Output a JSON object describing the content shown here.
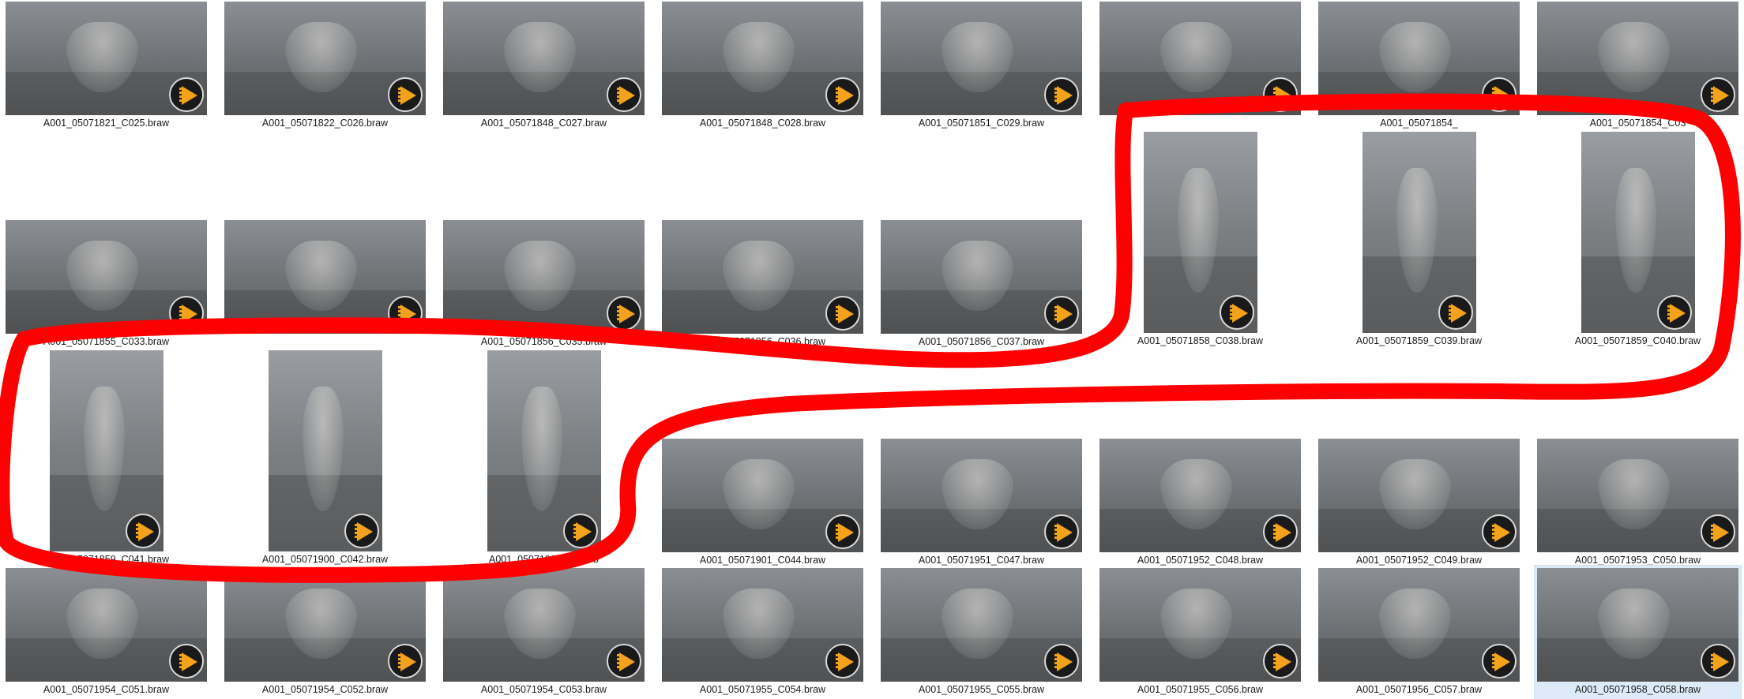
{
  "view": {
    "annotation_color": "#ff0000",
    "badge_icon": "braw-play-icon",
    "selected_item": "A001_05071958_C058.braw"
  },
  "items": [
    {
      "name": "A001_05071821_C025.braw",
      "orientation": "landscape"
    },
    {
      "name": "A001_05071822_C026.braw",
      "orientation": "landscape"
    },
    {
      "name": "A001_05071848_C027.braw",
      "orientation": "landscape"
    },
    {
      "name": "A001_05071848_C028.braw",
      "orientation": "landscape"
    },
    {
      "name": "A001_05071851_C029.braw",
      "orientation": "landscape"
    },
    {
      "name": "",
      "orientation": "landscape"
    },
    {
      "name": "A001_05071854_",
      "orientation": "landscape"
    },
    {
      "name": "A001_05071854_C03",
      "orientation": "landscape"
    },
    {
      "name": "A001_05071855_C033.braw",
      "orientation": "landscape"
    },
    {
      "name": "",
      "orientation": "landscape"
    },
    {
      "name": "A001_05071856_C035.braw",
      "orientation": "landscape"
    },
    {
      "name": "A001_05071856_C036.braw",
      "orientation": "landscape"
    },
    {
      "name": "A001_05071856_C037.braw",
      "orientation": "landscape"
    },
    {
      "name": "A001_05071858_C038.braw",
      "orientation": "portrait"
    },
    {
      "name": "A001_05071859_C039.braw",
      "orientation": "portrait"
    },
    {
      "name": "A001_05071859_C040.braw",
      "orientation": "portrait"
    },
    {
      "name": "A001_05071859_C041.braw",
      "orientation": "portrait"
    },
    {
      "name": "A001_05071900_C042.braw",
      "orientation": "portrait"
    },
    {
      "name": "A001_05071900_C043.b",
      "orientation": "portrait"
    },
    {
      "name": "A001_05071901_C044.braw",
      "orientation": "landscape"
    },
    {
      "name": "A001_05071951_C047.braw",
      "orientation": "landscape"
    },
    {
      "name": "A001_05071952_C048.braw",
      "orientation": "landscape"
    },
    {
      "name": "A001_05071952_C049.braw",
      "orientation": "landscape"
    },
    {
      "name": "A001_05071953_C050.braw",
      "orientation": "landscape"
    },
    {
      "name": "A001_05071954_C051.braw",
      "orientation": "landscape"
    },
    {
      "name": "A001_05071954_C052.braw",
      "orientation": "landscape"
    },
    {
      "name": "A001_05071954_C053.braw",
      "orientation": "landscape"
    },
    {
      "name": "A001_05071955_C054.braw",
      "orientation": "landscape"
    },
    {
      "name": "A001_05071955_C055.braw",
      "orientation": "landscape"
    },
    {
      "name": "A001_05071955_C056.braw",
      "orientation": "landscape"
    },
    {
      "name": "A001_05071956_C057.braw",
      "orientation": "landscape"
    },
    {
      "name": "A001_05071958_C058.braw",
      "orientation": "landscape"
    }
  ]
}
